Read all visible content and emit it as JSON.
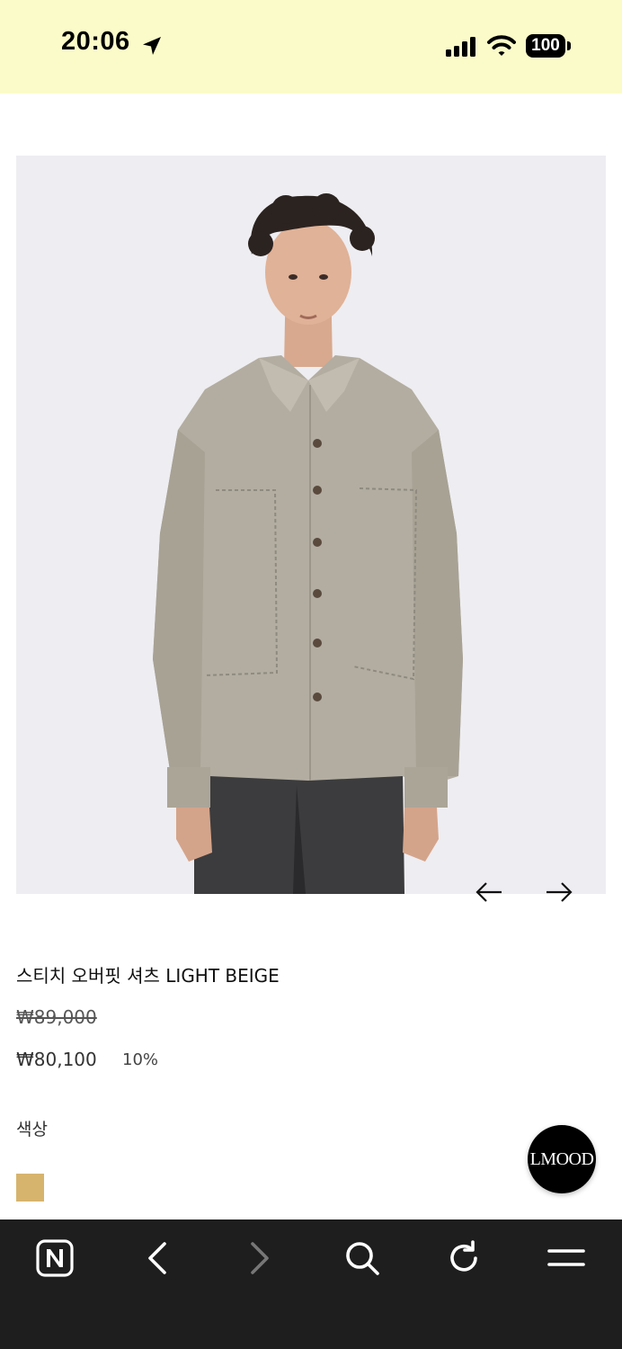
{
  "status_bar": {
    "time": "20:06",
    "battery": "100",
    "icons": [
      "location-arrow-icon",
      "signal-icon",
      "wifi-icon",
      "battery-icon"
    ],
    "background": "#fbfbc9"
  },
  "product": {
    "image_alt": "model-wearing-shirt",
    "name": "스티치 오버핏 셔츠 LIGHT BEIGE",
    "original_price": "₩89,000",
    "sale_price": "₩80,100",
    "discount_rate": "10%",
    "color_label": "색상",
    "color_swatch": "#d6b46e"
  },
  "carousel": {
    "prev_icon": "arrow-left-icon",
    "next_icon": "arrow-right-icon"
  },
  "brand_button": {
    "label": "LMOOD"
  },
  "browser_toolbar": {
    "background": "#1e1e1e",
    "items": [
      "naver-home-icon",
      "back-icon",
      "forward-icon",
      "search-icon",
      "reload-icon",
      "menu-icon"
    ]
  }
}
